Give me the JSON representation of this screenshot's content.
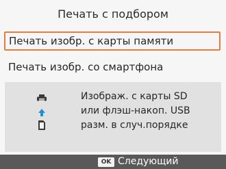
{
  "title": "Печать с подбором",
  "menu": {
    "items": [
      {
        "label": "Печать изобр. с карты памяти",
        "selected": true
      },
      {
        "label": "Печать изобр. со смартфона",
        "selected": false
      }
    ]
  },
  "info": {
    "lines": [
      "Изображ. с карты SD",
      "или флэш-накоп. USB",
      "разм. в случ.порядке"
    ],
    "icons": [
      "printer-icon",
      "up-arrow-icon",
      "memory-card-icon"
    ]
  },
  "footer": {
    "ok_label": "OK",
    "next_label": "Следующий"
  },
  "colors": {
    "accent": "#e57b3e",
    "arrow": "#1f8fd6",
    "footer_bg": "#595959",
    "info_bg": "#e1e1e1"
  }
}
